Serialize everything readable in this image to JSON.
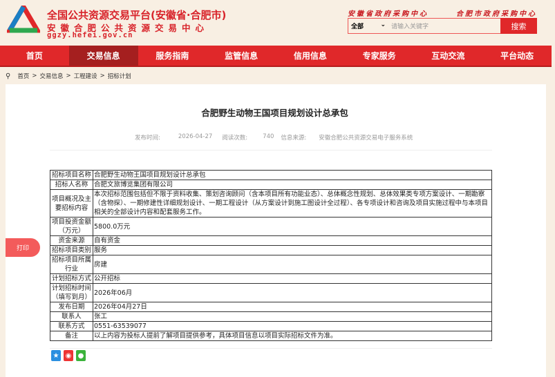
{
  "header": {
    "title": "全国公共资源交易平台(安徽省·合肥市)",
    "subtitle": "安徽合肥公共资源交易中心",
    "domain": "ggzy.hefei.gov.cn",
    "gov_link1": "安徽省政府采购中心",
    "gov_link2": "合肥市政府采购中心"
  },
  "search": {
    "scope": "全部",
    "placeholder": "请输入关键字",
    "button": "搜索"
  },
  "nav": [
    "首页",
    "交易信息",
    "服务指南",
    "监管信息",
    "信用信息",
    "专家服务",
    "互动交流",
    "平台动态"
  ],
  "breadcrumb": [
    "首页",
    "交易信息",
    "工程建设",
    "招标计划"
  ],
  "article": {
    "title": "合肥野生动物王国项目规划设计总承包",
    "publish_label": "发布时间:",
    "publish_date": "2026-04-27",
    "views_label": "阅读次数:",
    "views": "740",
    "source_label": "信息来源:",
    "source": "安徽合肥公共资源交易电子服务系统"
  },
  "table": [
    {
      "label": "招标项目名称",
      "value": "合肥野生动物王国项目规划设计总承包"
    },
    {
      "label": "招标人名称",
      "value": "合肥文旅博览集团有限公司"
    },
    {
      "label": "项目概况及主要招标内容",
      "value": "本次招标范围包括但不限于资料收集、策划咨询顾问（含本项目所有功能业态）、总体概念性规划、总体效果类专项方案设计、一期勘察（含物探）、一期修建性详细规划设计、一期工程设计（从方案设计到施工图设计全过程）、各专项设计和咨询及项目实施过程中与本项目相关的全部设计内容和配套服务工作。"
    },
    {
      "label": "项目投资金额（万元）",
      "value": "5800.0万元"
    },
    {
      "label": "资金来源",
      "value": "自有资金"
    },
    {
      "label": "招标项目类别",
      "value": "服务"
    },
    {
      "label": "招标项目所属行业",
      "value": "房建"
    },
    {
      "label": "计划招标方式",
      "value": "公开招标"
    },
    {
      "label": "计划招标时间（填写到月）",
      "value": "2026年06月"
    },
    {
      "label": "发布日期",
      "value": "2026年04月27日"
    },
    {
      "label": "联系人",
      "value": "张工"
    },
    {
      "label": "联系方式",
      "value": "0551-63539077"
    },
    {
      "label": "备注",
      "value": "以上内容为投标人提前了解项目提供参考，具体项目信息以项目实际招标文件为准。"
    }
  ],
  "print": "打印"
}
